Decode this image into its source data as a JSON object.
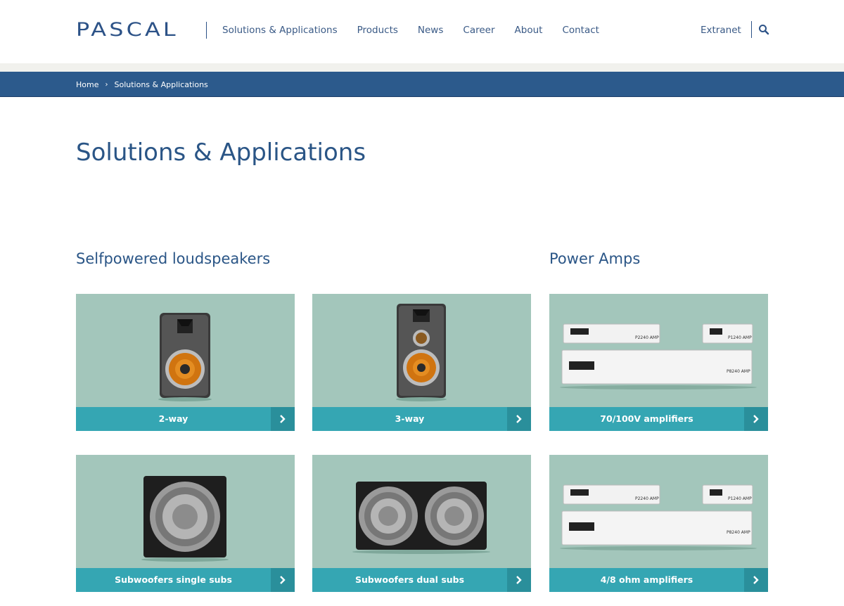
{
  "header": {
    "logo": "PASCAL",
    "nav": [
      "Solutions & Applications",
      "Products",
      "News",
      "Career",
      "About",
      "Contact"
    ],
    "extranet": "Extranet",
    "search_icon": "search-icon"
  },
  "breadcrumb": {
    "home": "Home",
    "separator": "›",
    "current": "Solutions & Applications"
  },
  "page_title": "Solutions & Applications",
  "sections": {
    "loudspeakers": "Selfpowered loudspeakers",
    "power_amps": "Power Amps"
  },
  "cards": [
    {
      "label": "2-way",
      "image": "bookshelf-speaker-2way"
    },
    {
      "label": "3-way",
      "image": "bookshelf-speaker-3way"
    },
    {
      "label": "70/100V amplifiers",
      "image": "rack-amplifiers"
    },
    {
      "label": "Subwoofers single subs",
      "image": "single-subwoofer"
    },
    {
      "label": "Subwoofers dual subs",
      "image": "dual-subwoofer"
    },
    {
      "label": "4/8 ohm amplifiers",
      "image": "rack-amplifiers"
    }
  ],
  "amp_labels": {
    "small": "P2240 AMP",
    "small2": "P1240 AMP",
    "large": "P8240 AMP"
  },
  "colors": {
    "brand": "#2c5287",
    "breadcrumb_bar": "#2c5a8c",
    "card_bg": "#a3c6bb",
    "caption": "#35a6b3",
    "caption_button": "#2a8f9b"
  }
}
